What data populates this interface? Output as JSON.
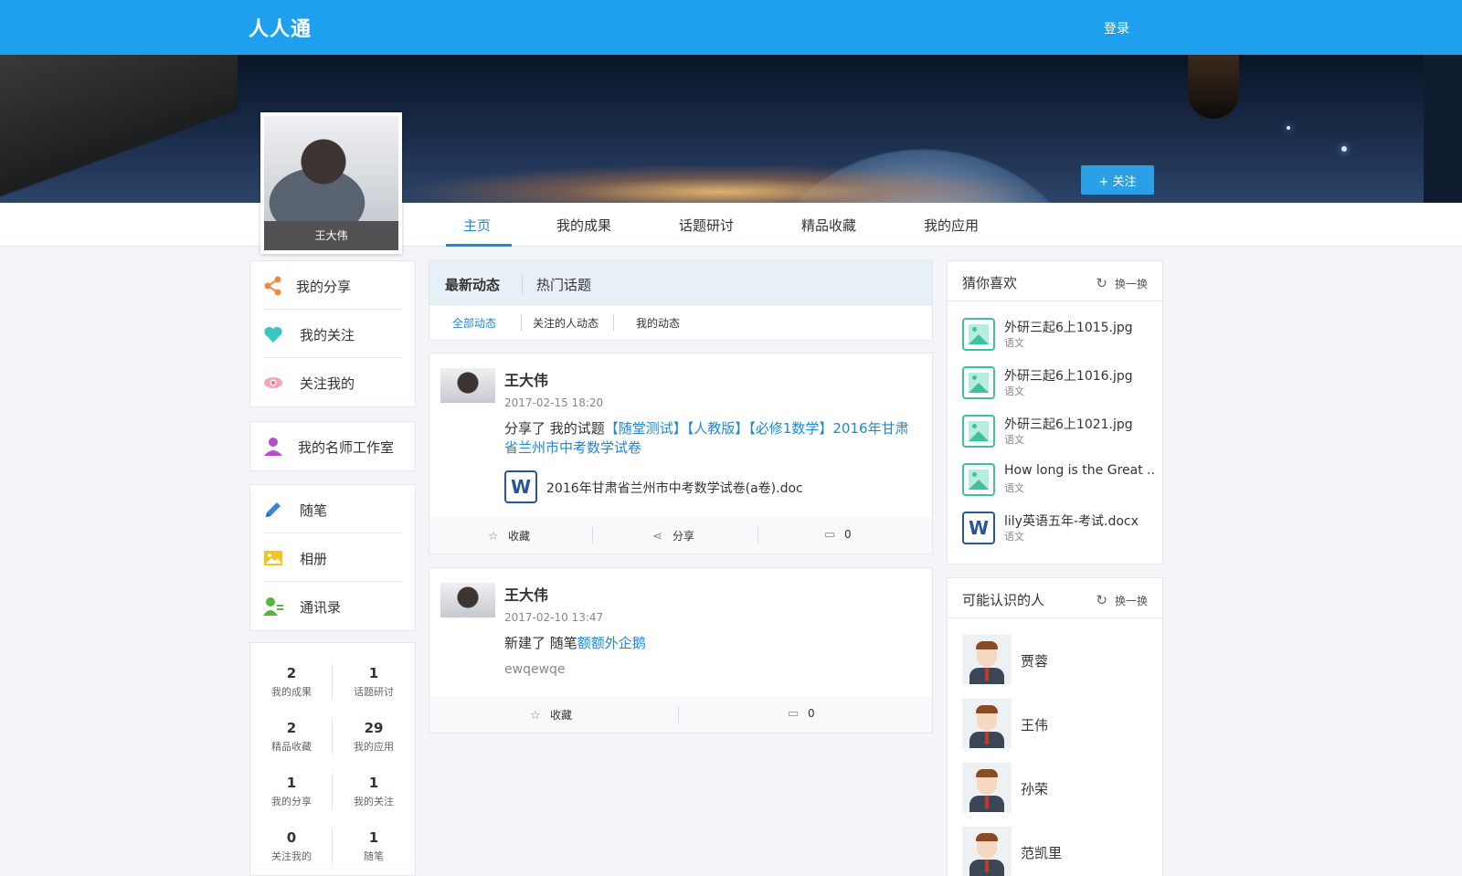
{
  "header": {
    "logo": "人人通",
    "login_label": "登录"
  },
  "banner": {
    "follow_label": "+ 关注"
  },
  "profile": {
    "name": "王大伟"
  },
  "nav": {
    "tabs": [
      {
        "label": "主页",
        "active": true
      },
      {
        "label": "我的成果"
      },
      {
        "label": "话题研讨"
      },
      {
        "label": "精品收藏"
      },
      {
        "label": "我的应用"
      }
    ]
  },
  "sidebar": {
    "group1": [
      {
        "label": "我的分享",
        "icon": "share-icon",
        "color": "#f08a3c"
      },
      {
        "label": "我的关注",
        "icon": "heart-icon",
        "color": "#3cc6c2"
      },
      {
        "label": "关注我的",
        "icon": "eye-icon",
        "color": "#f06f8d"
      }
    ],
    "group2": [
      {
        "label": "我的名师工作室",
        "icon": "teacher-icon",
        "color": "#b44fc4"
      }
    ],
    "group3": [
      {
        "label": "随笔",
        "icon": "pencil-icon",
        "color": "#3a86d6"
      },
      {
        "label": "相册",
        "icon": "album-icon",
        "color": "#f5c518"
      },
      {
        "label": "通讯录",
        "icon": "contacts-icon",
        "color": "#55b83a"
      }
    ],
    "stats": [
      {
        "value": "2",
        "label": "我的成果"
      },
      {
        "value": "1",
        "label": "话题研讨"
      },
      {
        "value": "2",
        "label": "精品收藏"
      },
      {
        "value": "29",
        "label": "我的应用"
      },
      {
        "value": "1",
        "label": "我的分享"
      },
      {
        "value": "1",
        "label": "我的关注"
      },
      {
        "value": "0",
        "label": "关注我的"
      },
      {
        "value": "1",
        "label": "随笔"
      }
    ]
  },
  "feed": {
    "tabs": [
      "最新动态",
      "热门话题"
    ],
    "subtabs": [
      "全部动态",
      "关注的人动态",
      "我的动态"
    ],
    "posts": [
      {
        "author": "王大伟",
        "time": "2017-02-15 18:20",
        "prefix": "分享了 我的试题",
        "link": "【随堂测试】【人教版】【必修1数学】2016年甘肃省兰州市中考数学试卷",
        "file_icon": "word-icon",
        "file_icon_letter": "W",
        "file_name": "2016年甘肃省兰州市中考数学试卷(a卷).doc",
        "actions": {
          "collect": "收藏",
          "share": "分享",
          "comments": "0"
        }
      },
      {
        "author": "王大伟",
        "time": "2017-02-10 13:47",
        "prefix": "新建了 随笔",
        "link": "额额外企鹅",
        "snippet": "ewqewqe",
        "actions": {
          "collect": "收藏",
          "comments": "0"
        }
      }
    ]
  },
  "guess": {
    "title": "猜你喜欢",
    "refresh_label": "换一换",
    "items": [
      {
        "name": "外研三起6上1015.jpg",
        "subject": "语文",
        "icon": "image-icon"
      },
      {
        "name": "外研三起6上1016.jpg",
        "subject": "语文",
        "icon": "image-icon"
      },
      {
        "name": "外研三起6上1021.jpg",
        "subject": "语文",
        "icon": "image-icon"
      },
      {
        "name": "How long is the Great ...",
        "subject": "语文",
        "icon": "image-icon"
      },
      {
        "name": "lily英语五年-考试.docx",
        "subject": "语文",
        "icon": "word-icon",
        "letter": "W"
      }
    ]
  },
  "people": {
    "title": "可能认识的人",
    "refresh_label": "换一换",
    "items": [
      {
        "name": "贾蓉"
      },
      {
        "name": "王伟"
      },
      {
        "name": "孙荣"
      },
      {
        "name": "范凯里"
      }
    ]
  }
}
